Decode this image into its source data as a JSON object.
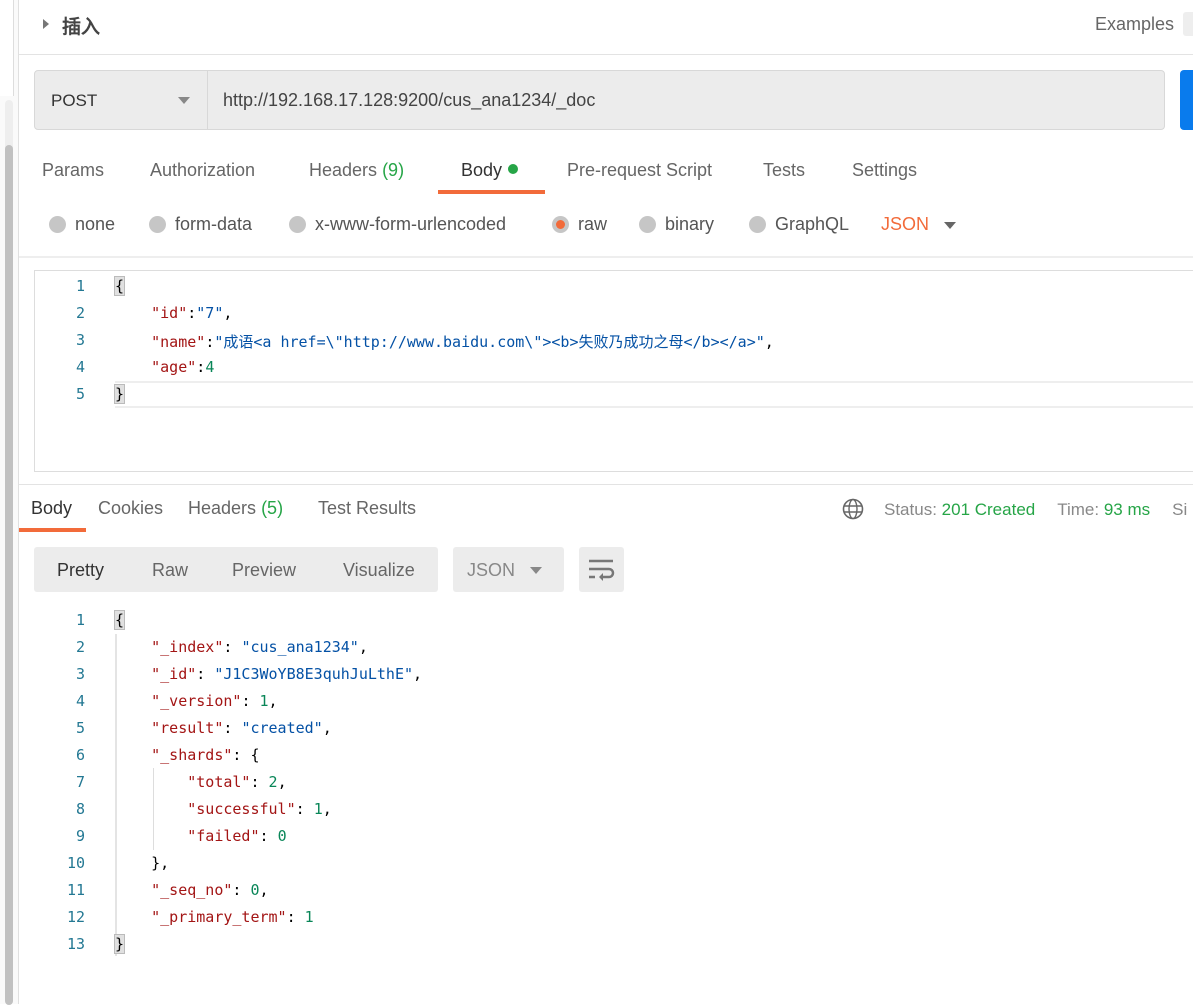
{
  "header": {
    "title": "插入",
    "examples_label": "Examples"
  },
  "request": {
    "method": "POST",
    "url": "http://192.168.17.128:9200/cus_ana1234/_doc",
    "tabs": [
      {
        "label": "Params"
      },
      {
        "label": "Authorization"
      },
      {
        "label": "Headers",
        "count": "(9)"
      },
      {
        "label": "Body"
      },
      {
        "label": "Pre-request Script"
      },
      {
        "label": "Tests"
      },
      {
        "label": "Settings"
      }
    ],
    "active_tab": "Body",
    "body_types": [
      {
        "label": "none"
      },
      {
        "label": "form-data"
      },
      {
        "label": "x-www-form-urlencoded"
      },
      {
        "label": "raw"
      },
      {
        "label": "binary"
      },
      {
        "label": "GraphQL"
      }
    ],
    "selected_body_type": "raw",
    "format": "JSON",
    "code": [
      [
        [
          "p",
          "{"
        ]
      ],
      [
        [
          "k",
          "    \"id\""
        ],
        [
          "p",
          ":"
        ],
        [
          "s",
          "\"7\""
        ],
        [
          "p",
          ","
        ]
      ],
      [
        [
          "k",
          "    \"name\""
        ],
        [
          "p",
          ":"
        ],
        [
          "s",
          "\"成语<a href=\\\"http://www.baidu.com\\\"><b>失败乃成功之母</b></a>\""
        ],
        [
          "p",
          ","
        ]
      ],
      [
        [
          "k",
          "    \"age\""
        ],
        [
          "p",
          ":"
        ],
        [
          "n",
          "4"
        ]
      ],
      [
        [
          "p",
          "}"
        ]
      ]
    ]
  },
  "response": {
    "tabs": [
      {
        "label": "Body"
      },
      {
        "label": "Cookies"
      },
      {
        "label": "Headers",
        "count": "(5)"
      },
      {
        "label": "Test Results"
      }
    ],
    "active_tab": "Body",
    "status_label": "Status:",
    "status": "201 Created",
    "time_label": "Time:",
    "time": "93 ms",
    "size_label_partial": "Si",
    "views": [
      "Pretty",
      "Raw",
      "Preview",
      "Visualize"
    ],
    "active_view": "Pretty",
    "format": "JSON",
    "code": [
      [
        [
          "p",
          "{"
        ]
      ],
      [
        [
          "k",
          "    \"_index\""
        ],
        [
          "p",
          ": "
        ],
        [
          "s",
          "\"cus_ana1234\""
        ],
        [
          "p",
          ","
        ]
      ],
      [
        [
          "k",
          "    \"_id\""
        ],
        [
          "p",
          ": "
        ],
        [
          "s",
          "\"J1C3WoYB8E3quhJuLthE\""
        ],
        [
          "p",
          ","
        ]
      ],
      [
        [
          "k",
          "    \"_version\""
        ],
        [
          "p",
          ": "
        ],
        [
          "n",
          "1"
        ],
        [
          "p",
          ","
        ]
      ],
      [
        [
          "k",
          "    \"result\""
        ],
        [
          "p",
          ": "
        ],
        [
          "s",
          "\"created\""
        ],
        [
          "p",
          ","
        ]
      ],
      [
        [
          "k",
          "    \"_shards\""
        ],
        [
          "p",
          ": {"
        ]
      ],
      [
        [
          "k",
          "        \"total\""
        ],
        [
          "p",
          ": "
        ],
        [
          "n",
          "2"
        ],
        [
          "p",
          ","
        ]
      ],
      [
        [
          "k",
          "        \"successful\""
        ],
        [
          "p",
          ": "
        ],
        [
          "n",
          "1"
        ],
        [
          "p",
          ","
        ]
      ],
      [
        [
          "k",
          "        \"failed\""
        ],
        [
          "p",
          ": "
        ],
        [
          "n",
          "0"
        ]
      ],
      [
        [
          "p",
          "    },"
        ]
      ],
      [
        [
          "k",
          "    \"_seq_no\""
        ],
        [
          "p",
          ": "
        ],
        [
          "n",
          "0"
        ],
        [
          "p",
          ","
        ]
      ],
      [
        [
          "k",
          "    \"_primary_term\""
        ],
        [
          "p",
          ": "
        ],
        [
          "n",
          "1"
        ]
      ],
      [
        [
          "p",
          "}"
        ]
      ]
    ]
  },
  "colors": {
    "accent": "#f26b3a",
    "success": "#26a547",
    "send": "#097bed"
  }
}
